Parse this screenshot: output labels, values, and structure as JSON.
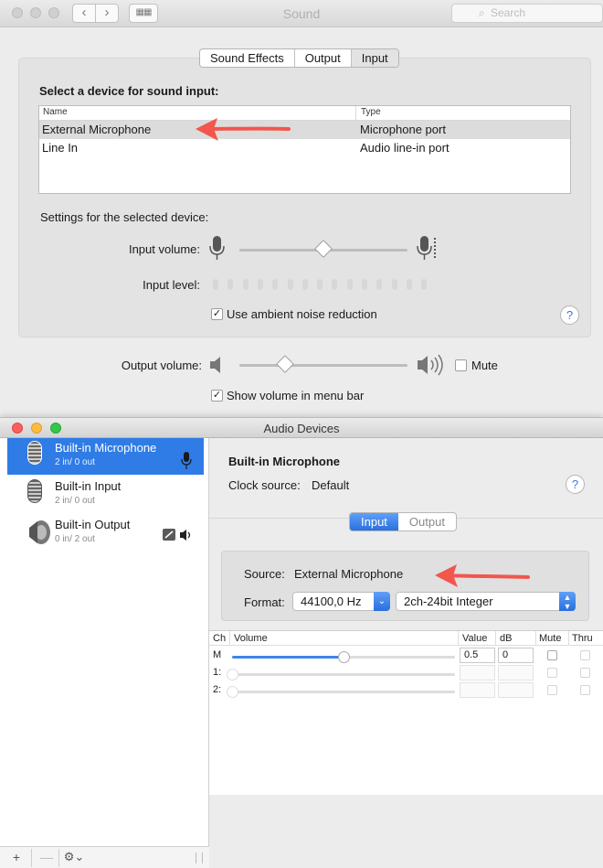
{
  "sound_window": {
    "title": "Sound",
    "search_placeholder": "Search",
    "tabs": [
      "Sound Effects",
      "Output",
      "Input"
    ],
    "selected_tab": "Input",
    "heading": "Select a device for sound input:",
    "table_headers": {
      "name": "Name",
      "type": "Type"
    },
    "devices": [
      {
        "name": "External Microphone",
        "type": "Microphone port",
        "selected": true
      },
      {
        "name": "Line In",
        "type": "Audio line-in port",
        "selected": false
      }
    ],
    "settings_label": "Settings for the selected device:",
    "input_volume_label": "Input volume:",
    "input_volume_level": 0.5,
    "input_level_label": "Input level:",
    "ambient_noise_label": "Use ambient noise reduction",
    "ambient_noise_checked": true,
    "help": "?",
    "output_volume_label": "Output volume:",
    "output_volume_level": 0.27,
    "mute_label": "Mute",
    "show_volume_label": "Show volume in menu bar",
    "show_volume_checked": true
  },
  "audio_window": {
    "title": "Audio Devices",
    "devices": [
      {
        "name": "Built-in Microphone",
        "io": "2 in/ 0 out",
        "selected": true
      },
      {
        "name": "Built-in Input",
        "io": "2 in/ 0 out",
        "selected": false
      },
      {
        "name": "Built-in Output",
        "io": "0 in/ 2 out",
        "selected": false
      }
    ],
    "bottom_bar": {
      "add": "+",
      "remove": "—",
      "gear": "⚙︎⌄"
    },
    "detail_title": "Built-in Microphone",
    "clock_source_label": "Clock source:",
    "clock_source_value": "Default",
    "help": "?",
    "io_tabs": [
      "Input",
      "Output"
    ],
    "selected_io_tab": "Input",
    "source_label": "Source:",
    "source_value": "External Microphone",
    "format_label": "Format:",
    "sample_rate": "44100,0 Hz",
    "bit_format": "2ch-24bit Integer",
    "channel_headers": {
      "ch": "Ch",
      "volume": "Volume",
      "value": "Value",
      "db": "dB",
      "mute": "Mute",
      "thru": "Thru"
    },
    "channels": [
      {
        "ch": "M",
        "value": "0.5",
        "db": "0",
        "level": 0.5,
        "enabled": true
      },
      {
        "ch": "1:",
        "value": "",
        "db": "",
        "level": 0,
        "enabled": false
      },
      {
        "ch": "2:",
        "value": "",
        "db": "",
        "level": 0,
        "enabled": false
      }
    ]
  },
  "colors": {
    "accent": "#2f7ce6",
    "arrow": "#f2564d"
  }
}
